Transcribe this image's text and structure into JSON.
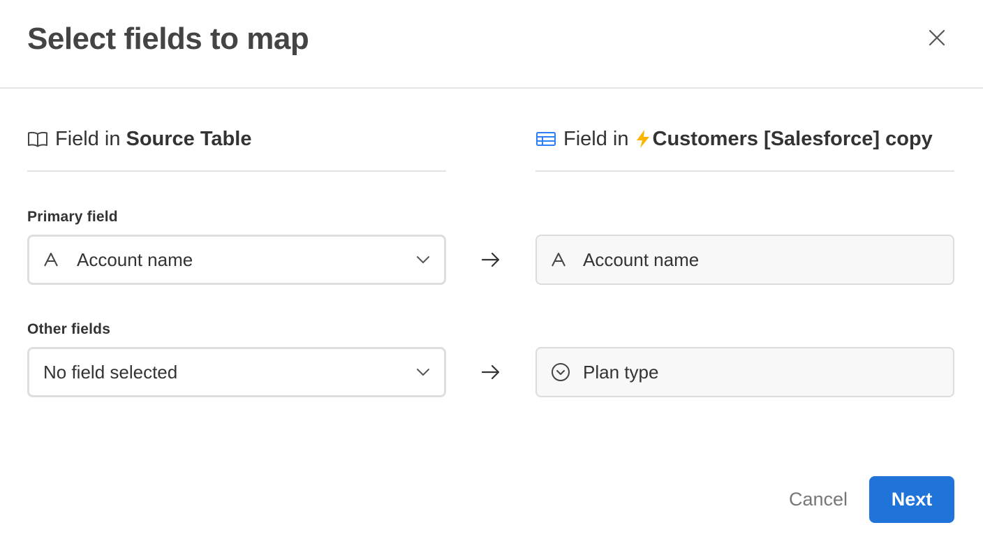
{
  "dialog": {
    "title": "Select fields to map",
    "close_icon": "close-icon"
  },
  "source_column": {
    "icon": "book-icon",
    "prefix": "Field in",
    "table_name": "Source Table"
  },
  "target_column": {
    "icon": "grid-table-icon",
    "prefix": "Field in",
    "sync_icon": "lightning-bolt-icon",
    "table_name": "Customers [Salesforce] copy"
  },
  "primary_field": {
    "label": "Primary field",
    "source_icon": "text-field-icon",
    "source_value": "Account name",
    "target_icon": "text-field-icon",
    "target_value": "Account name"
  },
  "other_fields": {
    "label": "Other fields",
    "source_value": "No field selected",
    "target_icon": "single-select-icon",
    "target_value": "Plan type"
  },
  "footer": {
    "cancel_label": "Cancel",
    "next_label": "Next"
  },
  "colors": {
    "primary_button": "#1f73d9",
    "table_icon": "#2d7ff9",
    "bolt": "#fcb400"
  }
}
